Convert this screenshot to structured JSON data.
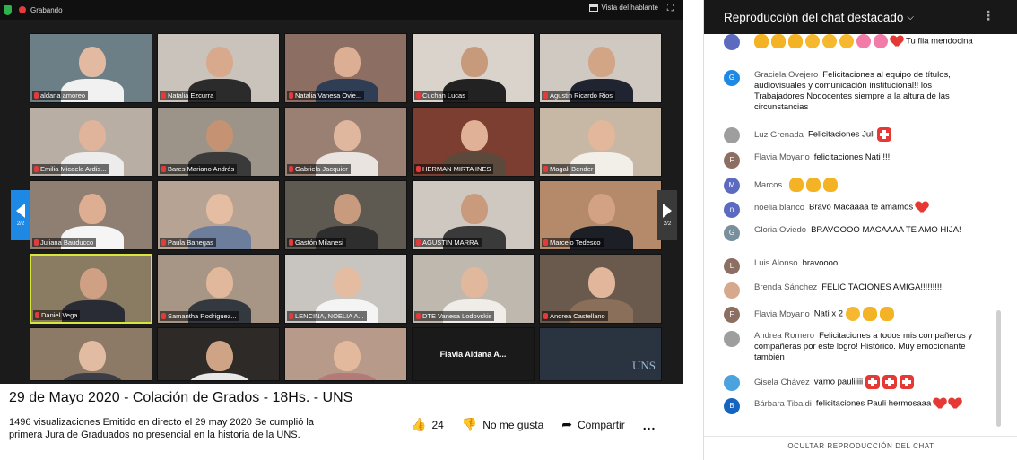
{
  "zoom": {
    "recording_label": "Grabando",
    "speaker_view_label": "Vista del hablante",
    "pager_left": "2/2",
    "pager_right": "2/2",
    "tiles": [
      {
        "name": "aldana amoreo",
        "bg": "#6d7f86",
        "skin": "#e2b9a1",
        "cloth": "#f1f1f1"
      },
      {
        "name": "Natalia Ezcurra",
        "bg": "#c9c3bb",
        "skin": "#d9a98e",
        "cloth": "#2b2b2b"
      },
      {
        "name": "Natalia Vanesa Ovie...",
        "bg": "#8c6f62",
        "skin": "#dcae93",
        "cloth": "#2f3d55"
      },
      {
        "name": "Cuchan Lucas",
        "bg": "#d9d3cc",
        "skin": "#c89a7c",
        "cloth": "#222"
      },
      {
        "name": "Agustin Ricardo Rios",
        "bg": "#cfc9c1",
        "skin": "#d2a587",
        "cloth": "#1f2430"
      },
      {
        "name": "Emilia Micaela Ardis...",
        "bg": "#b8aea3",
        "skin": "#e0b49b",
        "cloth": "#ececec"
      },
      {
        "name": "Bares Mariano Andrés",
        "bg": "#9c9488",
        "skin": "#c59374",
        "cloth": "#3a3a3a"
      },
      {
        "name": "Gabriela Jacquier",
        "bg": "#9a7f73",
        "skin": "#dfb79e",
        "cloth": "#e9e4df"
      },
      {
        "name": "HERMAN MIRTA INES",
        "bg": "#7b3e30",
        "skin": "#e0b197",
        "cloth": "#5b4a3c"
      },
      {
        "name": "Magali Bender",
        "bg": "#c7b7a5",
        "skin": "#e3b79c",
        "cloth": "#f2efe9"
      },
      {
        "name": "Juliana Bauducco",
        "bg": "#8f7f73",
        "skin": "#deae92",
        "cloth": "#f5f5f5"
      },
      {
        "name": "Paula Banegas",
        "bg": "#b7a394",
        "skin": "#e4bda2",
        "cloth": "#6d7e9c"
      },
      {
        "name": "Gastón Milanesi",
        "bg": "#5e5a52",
        "skin": "#c99b7e",
        "cloth": "#2e2e2e"
      },
      {
        "name": "AGUSTIN MARRA",
        "bg": "#cfc8c0",
        "skin": "#c99a7b",
        "cloth": "#3a3a3a"
      },
      {
        "name": "Marcelo Tedesco",
        "bg": "#b58a6a",
        "skin": "#d3a285",
        "cloth": "#1d1f26"
      },
      {
        "name": "Daniel Vega",
        "bg": "#8a7b63",
        "skin": "#cfa084",
        "cloth": "#2a2c35"
      },
      {
        "name": "Samantha Rodriguez...",
        "bg": "#a79685",
        "skin": "#e2b89c",
        "cloth": "#34383f"
      },
      {
        "name": "LENCINA, NOELIA A...",
        "bg": "#c8c4bf",
        "skin": "#e4bca1",
        "cloth": "#f4f4f4"
      },
      {
        "name": "DTE Vanesa Lodovskis",
        "bg": "#bfb8ae",
        "skin": "#e2b89d",
        "cloth": "#f0ede8"
      },
      {
        "name": "Andrea Castellano",
        "bg": "#6a5a4e",
        "skin": "#e1b69a",
        "cloth": "#8a6f5a"
      },
      {
        "name": "",
        "bg": "#8c7a66",
        "skin": "#e1bba2",
        "cloth": "#3b3e46"
      },
      {
        "name": "",
        "bg": "#2d2a27",
        "skin": "#cfa386",
        "cloth": "#e8e8e8"
      },
      {
        "name": "",
        "bg": "#b79a8a",
        "skin": "#e3b99d",
        "cloth": "#b37a78"
      },
      {
        "name": "Flavia Aldana A...",
        "bg": "#1a1a1a",
        "skin": "",
        "cloth": ""
      },
      {
        "name": "UNS",
        "bg": "#2a3440",
        "skin": "",
        "cloth": ""
      }
    ]
  },
  "video": {
    "title": "29 de Mayo 2020 - Colación de Grados - 18Hs. - UNS",
    "stats": "1496 visualizaciones  Emitido en directo el 29 may 2020",
    "description": "Se cumplió la primera Jura de Graduados no presencial en la historia de la UNS.",
    "likes": "24",
    "dislike_label": "No me gusta",
    "share_label": "Compartir",
    "more_label": "..."
  },
  "chat": {
    "header_title": "Reproducción del chat destacado",
    "footer_label": "OCULTAR REPRODUCCIÓN DEL CHAT",
    "messages": [
      {
        "author": "",
        "text": "Tu flia mendocina",
        "avatar_letter": "",
        "avatar_color": "#5c6bc0",
        "emojis": [
          "clap",
          "clap",
          "clap",
          "face",
          "face",
          "face",
          "flower",
          "flower",
          "heart"
        ]
      },
      {
        "author": "Graciela Ovejero",
        "text": "Felicitaciones al equipo de títulos, audiovisuales y comunicación institucional!! los Trabajadores Nodocentes siempre a la altura de las circunstancias",
        "avatar_letter": "G",
        "avatar_color": "#1e88e5",
        "emojis": []
      },
      {
        "author": "Luz Grenada",
        "text": "Felicitaciones Juli",
        "avatar_letter": "",
        "avatar_color": "#9e9e9e",
        "emojis": [
          "swiss"
        ]
      },
      {
        "author": "Flavia Moyano",
        "text": "felicitaciones Nati !!!!",
        "avatar_letter": "F",
        "avatar_color": "#8d6e63",
        "emojis": []
      },
      {
        "author": "Marcos",
        "text": "",
        "avatar_letter": "M",
        "avatar_color": "#5c6bc0",
        "emojis": [
          "clap",
          "clap",
          "clap"
        ]
      },
      {
        "author": "noelia blanco",
        "text": "Bravo Macaaaa te amamos",
        "avatar_letter": "n",
        "avatar_color": "#5c6bc0",
        "emojis": [
          "heart"
        ]
      },
      {
        "author": "Gloria Oviedo",
        "text": "BRAVOOOO MACAAAA TE AMO HIJA!",
        "avatar_letter": "G",
        "avatar_color": "#78909c",
        "emojis": []
      },
      {
        "author": "Luis Alonso",
        "text": "bravoooo",
        "avatar_letter": "L",
        "avatar_color": "#8d6e63",
        "emojis": []
      },
      {
        "author": "Brenda Sánchez",
        "text": "FELICITACIONES AMIGA!!!!!!!!!",
        "avatar_letter": "",
        "avatar_color": "#d7a98c",
        "emojis": []
      },
      {
        "author": "Flavia Moyano",
        "text": "Nati x 2",
        "avatar_letter": "F",
        "avatar_color": "#8d6e63",
        "emojis": [
          "face",
          "clap",
          "clap"
        ]
      },
      {
        "author": "Andrea Romero",
        "text": "Felicitaciones a todos mis compañeros y compañeras por este logro! Histórico. Muy emocionante también",
        "avatar_letter": "",
        "avatar_color": "#9e9e9e",
        "emojis": []
      },
      {
        "author": "Gisela Chávez",
        "text": "vamo pauliiiii",
        "avatar_letter": "",
        "avatar_color": "#4aa3df",
        "emojis": [
          "swiss",
          "swiss",
          "swiss"
        ]
      },
      {
        "author": "Bárbara Tibaldi",
        "text": "felicitaciones Pauli hermosaaa",
        "avatar_letter": "B",
        "avatar_color": "#1565c0",
        "emojis": [
          "heart",
          "heart"
        ]
      }
    ]
  }
}
